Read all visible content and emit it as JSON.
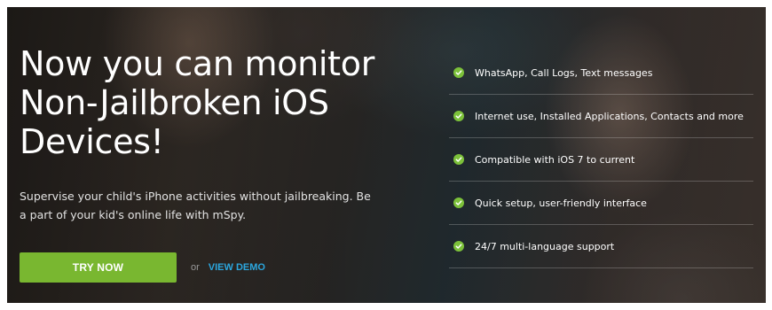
{
  "hero": {
    "headline": "Now you can monitor Non-Jailbroken iOS Devices!",
    "subtext": "Supervise your child's iPhone activities without jailbreaking. Be a part of your kid's online life with mSpy.",
    "try_button": "TRY NOW",
    "or_text": "or",
    "demo_link": "VIEW DEMO"
  },
  "features": [
    {
      "icon": "check-circle-icon",
      "label": "WhatsApp, Call Logs, Text messages"
    },
    {
      "icon": "check-circle-icon",
      "label": "Internet use, Installed Applications, Contacts and more"
    },
    {
      "icon": "check-circle-icon",
      "label": "Compatible with iOS 7 to current"
    },
    {
      "icon": "check-circle-icon",
      "label": "Quick setup, user-friendly interface"
    },
    {
      "icon": "check-circle-icon",
      "label": "24/7 multi-language support"
    }
  ],
  "colors": {
    "accent_green": "#79b730",
    "check_green": "#7cc13a",
    "link_blue": "#2ba6de"
  }
}
